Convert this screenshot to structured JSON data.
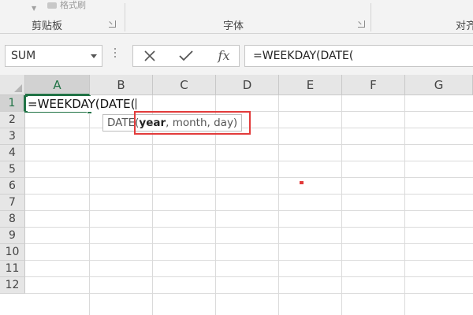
{
  "ribbon": {
    "top_partial_label": "格式刷",
    "groups": [
      {
        "label": "剪贴板"
      },
      {
        "label": "字体"
      },
      {
        "label": "对齐"
      }
    ]
  },
  "formula_bar": {
    "name_box_value": "SUM",
    "cancel_icon": "x-icon",
    "enter_icon": "check-icon",
    "insert_function_label": "fx",
    "formula_text": "=WEEKDAY(DATE("
  },
  "grid": {
    "columns": [
      "A",
      "B",
      "C",
      "D",
      "E",
      "F",
      "G"
    ],
    "rows": [
      "1",
      "2",
      "3",
      "4",
      "5",
      "6",
      "7",
      "8",
      "9",
      "10",
      "11",
      "12"
    ],
    "active_cell": "A1",
    "active_cell_text": "=WEEKDAY(DATE("
  },
  "tooltip": {
    "func_name": "DATE(",
    "arg_current": "year",
    "arg_rest": ", month, day)"
  },
  "colors": {
    "accent_green": "#217346",
    "highlight_red": "#e23b3b"
  }
}
